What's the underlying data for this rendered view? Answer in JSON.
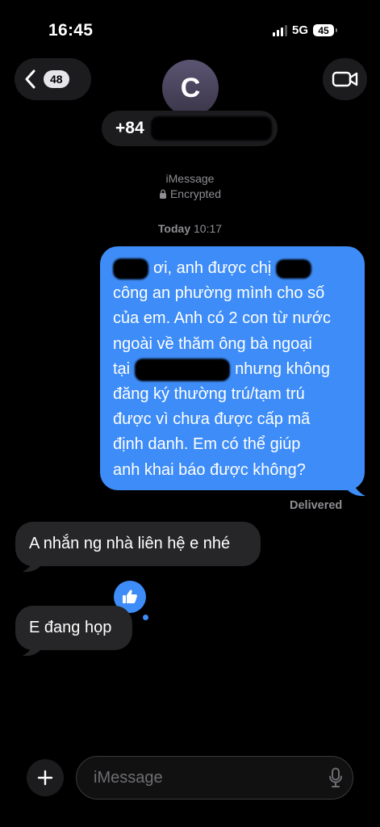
{
  "status_bar": {
    "time": "16:45",
    "network": "5G",
    "battery": "45"
  },
  "header": {
    "back_count": "48",
    "avatar_initial": "C",
    "contact_number_prefix": "+84"
  },
  "thread": {
    "service": "iMessage",
    "encrypted": "Encrypted",
    "date_day": "Today",
    "date_time": "10:17",
    "sent_lines": [
      "ơi, anh được chị",
      "công an phường mình cho số",
      "của em. Anh có 2 con từ nước",
      "ngoài về thăm ông bà ngoại",
      "nhưng không",
      "đăng ký thường trú/tạm trú",
      "được vì chưa được cấp mã",
      "định danh. Em có thể giúp",
      "anh khai báo được không?"
    ],
    "sent_line_prefix_5": "tại",
    "delivered": "Delivered",
    "received": [
      "A nhắn ng nhà liên hệ e nhé",
      "E đang họp"
    ]
  },
  "composer": {
    "placeholder": "iMessage"
  },
  "colors": {
    "accent": "#3e8cf7",
    "received_bubble": "#262628",
    "background": "#000000"
  },
  "icons": [
    "chevron-left-icon",
    "video-camera-icon",
    "lock-icon",
    "thumbs-up-icon",
    "plus-icon",
    "microphone-icon"
  ]
}
